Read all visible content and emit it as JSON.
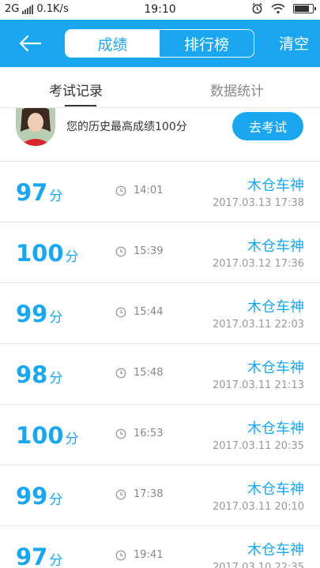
{
  "status_bar": {
    "network": "2G",
    "speed": "0.1K/s",
    "time": "19:10",
    "alarm_icon": "alarm-icon",
    "wifi_icon": "wifi-icon",
    "battery_level": 0.85
  },
  "header": {
    "back_icon": "arrow-left-icon",
    "segments": [
      {
        "label": "成绩",
        "active": true
      },
      {
        "label": "排行榜",
        "active": false
      }
    ],
    "clear_label": "清空",
    "accent_color": "#1aa7ef"
  },
  "tabs": [
    {
      "label": "考试记录",
      "active": true
    },
    {
      "label": "数据统计",
      "active": false
    }
  ],
  "summary": {
    "text": "您的历史最高成绩100分",
    "button_label": "去考试"
  },
  "records": [
    {
      "score": "97",
      "unit": "分",
      "duration": "14:01",
      "name": "木仓车神",
      "date": "2017.03.13  17:38"
    },
    {
      "score": "100",
      "unit": "分",
      "duration": "15:39",
      "name": "木仓车神",
      "date": "2017.03.12  17:36"
    },
    {
      "score": "99",
      "unit": "分",
      "duration": "15:44",
      "name": "木仓车神",
      "date": "2017.03.11  22:03"
    },
    {
      "score": "98",
      "unit": "分",
      "duration": "15:48",
      "name": "木仓车神",
      "date": "2017.03.11  21:13"
    },
    {
      "score": "100",
      "unit": "分",
      "duration": "16:53",
      "name": "木仓车神",
      "date": "2017.03.11  20:35"
    },
    {
      "score": "99",
      "unit": "分",
      "duration": "17:38",
      "name": "木仓车神",
      "date": "2017.03.11  20:10"
    },
    {
      "score": "97",
      "unit": "分",
      "duration": "19:41",
      "name": "木仓车神",
      "date": "2017.03.10  22:35"
    }
  ]
}
